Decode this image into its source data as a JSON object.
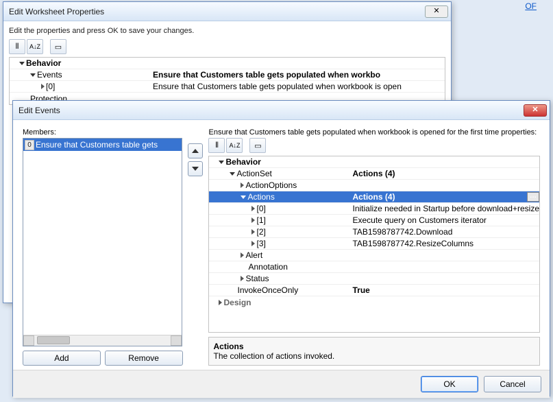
{
  "bg": {
    "link_fragment": "OF"
  },
  "win1": {
    "title": "Edit Worksheet Properties",
    "close_glyph": "✕",
    "instruction": "Edit the properties and press OK to save your changes.",
    "toolbar": {
      "categorized": "⦀",
      "alpha": "A↓Z",
      "pages": "▭"
    },
    "section_behavior": "Behavior",
    "rows": {
      "events": {
        "name": "Events",
        "value": "Ensure that Customers table gets populated when workbo"
      },
      "idx0": {
        "name": "[0]",
        "value": "Ensure that Customers table gets populated when workbook is open"
      },
      "prot": {
        "name": "Protection",
        "value": ""
      }
    }
  },
  "win2": {
    "title": "Edit Events",
    "close_glyph": "✕",
    "members_label": "Members:",
    "member_index": "0",
    "member_text": "Ensure that Customers table gets",
    "btn_add": "Add",
    "btn_remove": "Remove",
    "right_label": "Ensure that Customers table gets populated when workbook is opened for the first time properties:",
    "toolbar": {
      "categorized": "⦀",
      "alpha": "A↓Z",
      "pages": "▭"
    },
    "sections": {
      "behavior": "Behavior",
      "design": "Design"
    },
    "rows": {
      "actionset": {
        "name": "ActionSet",
        "value": "Actions (4)"
      },
      "actionoptions": {
        "name": "ActionOptions",
        "value": ""
      },
      "actions": {
        "name": "Actions",
        "value": "Actions (4)"
      },
      "a0": {
        "name": "[0]",
        "value": "Initialize needed in Startup before download+resize"
      },
      "a1": {
        "name": "[1]",
        "value": "Execute query on Customers iterator"
      },
      "a2": {
        "name": "[2]",
        "value": "TAB1598787742.Download"
      },
      "a3": {
        "name": "[3]",
        "value": "TAB1598787742.ResizeColumns"
      },
      "alert": {
        "name": "Alert",
        "value": ""
      },
      "annotation": {
        "name": "Annotation",
        "value": ""
      },
      "status": {
        "name": "Status",
        "value": ""
      },
      "invokeonce": {
        "name": "InvokeOnceOnly",
        "value": "True"
      }
    },
    "desc": {
      "title": "Actions",
      "text": "The collection of actions invoked."
    },
    "ellipsis": "…",
    "ok": "OK",
    "cancel": "Cancel"
  }
}
